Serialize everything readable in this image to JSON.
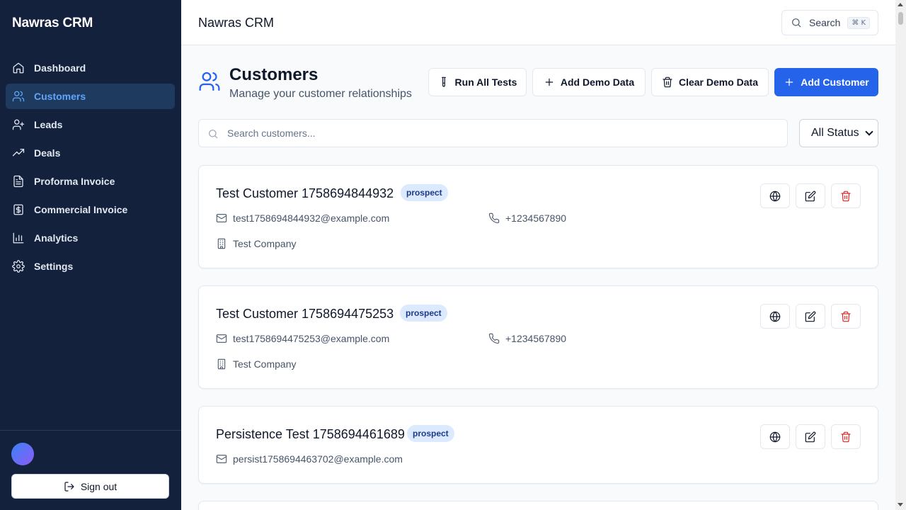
{
  "app": {
    "brand": "Nawras CRM",
    "header_title": "Nawras CRM"
  },
  "sidebar": {
    "items": [
      {
        "label": "Dashboard",
        "icon": "home-icon",
        "active": false
      },
      {
        "label": "Customers",
        "icon": "users-icon",
        "active": true
      },
      {
        "label": "Leads",
        "icon": "user-plus-icon",
        "active": false
      },
      {
        "label": "Deals",
        "icon": "trending-up-icon",
        "active": false
      },
      {
        "label": "Proforma Invoice",
        "icon": "file-text-icon",
        "active": false
      },
      {
        "label": "Commercial Invoice",
        "icon": "receipt-icon",
        "active": false
      },
      {
        "label": "Analytics",
        "icon": "bar-chart-icon",
        "active": false
      },
      {
        "label": "Settings",
        "icon": "gear-icon",
        "active": false
      }
    ],
    "sign_out": "Sign out"
  },
  "header": {
    "search_label": "Search",
    "shortcut": "⌘ K"
  },
  "page": {
    "title": "Customers",
    "subtitle": "Manage your customer relationships",
    "actions": {
      "run_tests": "Run All Tests",
      "add_demo": "Add Demo Data",
      "clear_demo": "Clear Demo Data",
      "add_customer": "Add Customer"
    },
    "search_placeholder": "Search customers...",
    "status_filter": "All Status"
  },
  "customers": [
    {
      "name": "Test Customer 1758694844932",
      "status": "prospect",
      "email": "test1758694844932@example.com",
      "phone": "+1234567890",
      "company": "Test Company"
    },
    {
      "name": "Test Customer 1758694475253",
      "status": "prospect",
      "email": "test1758694475253@example.com",
      "phone": "+1234567890",
      "company": "Test Company"
    },
    {
      "name": "Persistence Test 1758694461689",
      "status": "prospect",
      "email": "persist1758694463702@example.com",
      "phone": "",
      "company": ""
    }
  ],
  "colors": {
    "sidebar_bg": "#13213d",
    "accent": "#2563eb",
    "badge_bg": "#dbeafe",
    "danger": "#dc2626"
  }
}
